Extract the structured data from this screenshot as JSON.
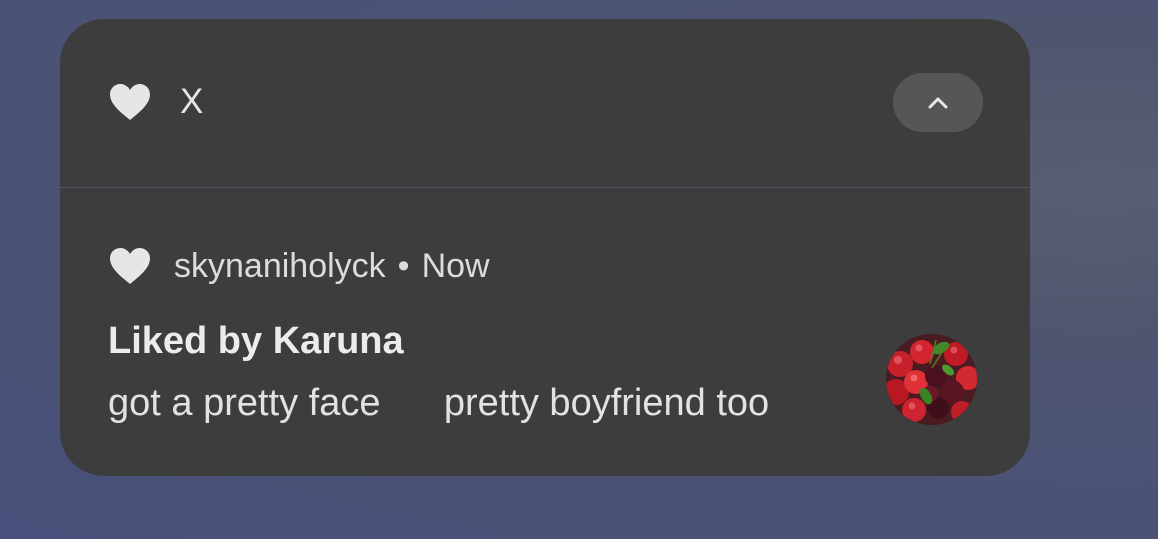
{
  "notification": {
    "app_name": "X",
    "app_icon": "heart-icon",
    "collapse_icon": "chevron-up-icon",
    "message": {
      "icon": "heart-icon",
      "sender": "skynaniholyck",
      "separator": "•",
      "time": "Now",
      "title": "Liked by Karuna",
      "text": "got a pretty face      pretty boyfriend too",
      "avatar": "cherries-avatar"
    }
  },
  "colors": {
    "card_background": "#3d3d3d",
    "button_background": "#565656",
    "icon": "#e6e6e6",
    "wallpaper": "#4a5276"
  }
}
